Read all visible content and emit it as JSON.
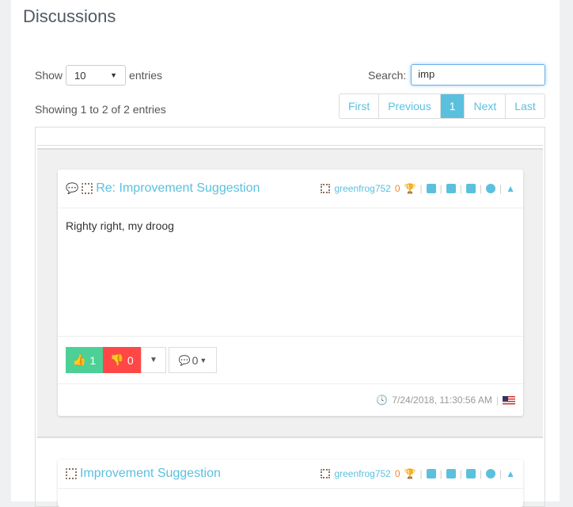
{
  "page": {
    "title": "Discussions"
  },
  "controls": {
    "show_label": "Show",
    "entries_value": "10",
    "entries_label": "entries",
    "search_label": "Search:",
    "search_value": "imp",
    "info": "Showing 1 to 2 of 2 entries"
  },
  "pagination": {
    "first": "First",
    "previous": "Previous",
    "current": "1",
    "next": "Next",
    "last": "Last"
  },
  "posts": [
    {
      "title": "Re: Improvement Suggestion",
      "author": "greenfrog752",
      "points": "0",
      "body": "Righty right, my droog",
      "upvotes": "1",
      "downvotes": "0",
      "comments": "0",
      "timestamp": "7/24/2018, 11:30:56 AM"
    },
    {
      "title": "Improvement Suggestion",
      "author": "greenfrog752",
      "points": "0"
    }
  ],
  "colors": {
    "accent": "#5bc0de",
    "upvote": "#4cd096",
    "downvote": "#ff4747",
    "points": "#f0882d"
  }
}
